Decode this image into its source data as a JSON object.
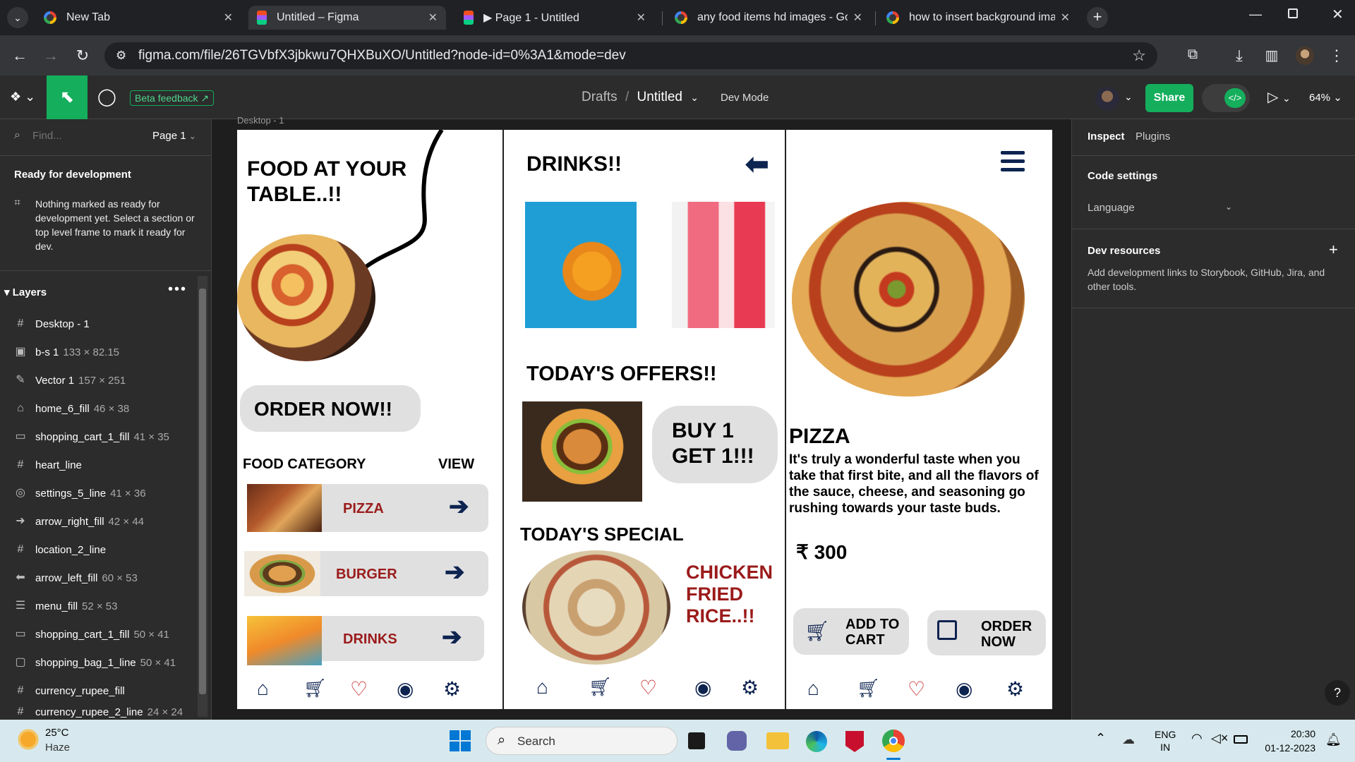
{
  "browser": {
    "tabs": [
      {
        "title": "New Tab"
      },
      {
        "title": "Untitled – Figma"
      },
      {
        "title": "▶ Page 1 - Untitled"
      },
      {
        "title": "any food items hd images - Goo"
      },
      {
        "title": "how to insert background imag"
      }
    ],
    "url": "figma.com/file/26TGVbfX3jbkwu7QHXBuXO/Untitled?node-id=0%3A1&mode=dev"
  },
  "figma": {
    "beta_feedback": "Beta feedback",
    "breadcrumb_drafts": "Drafts",
    "breadcrumb_sep": "/",
    "file_name": "Untitled",
    "dev_mode": "Dev Mode",
    "share": "Share",
    "zoom": "64%",
    "find_placeholder": "Find...",
    "page": "Page 1",
    "ready_title": "Ready for development",
    "ready_text": "Nothing marked as ready for development yet. Select a section or top level frame to mark it ready for dev.",
    "layers_title": "Layers",
    "layers": [
      {
        "name": "Desktop - 1",
        "dim": "",
        "icon": "frame-icon"
      },
      {
        "name": "b-s 1",
        "dim": "133 × 82.15",
        "icon": "image-icon"
      },
      {
        "name": "Vector 1",
        "dim": "157 × 251",
        "icon": "vector-icon"
      },
      {
        "name": "home_6_fill",
        "dim": "46 × 38",
        "icon": "home-icon"
      },
      {
        "name": "shopping_cart_1_fill",
        "dim": "41 × 35",
        "icon": "cart-icon"
      },
      {
        "name": "heart_line",
        "dim": "",
        "icon": "frame-icon"
      },
      {
        "name": "settings_5_line",
        "dim": "41 × 36",
        "icon": "settings-icon"
      },
      {
        "name": "arrow_right_fill",
        "dim": "42 × 44",
        "icon": "arrow-right-icon"
      },
      {
        "name": "location_2_line",
        "dim": "",
        "icon": "frame-icon"
      },
      {
        "name": "arrow_left_fill",
        "dim": "60 × 53",
        "icon": "arrow-left-icon"
      },
      {
        "name": "menu_fill",
        "dim": "52 × 53",
        "icon": "menu-icon"
      },
      {
        "name": "shopping_cart_1_fill",
        "dim": "50 × 41",
        "icon": "cart-icon"
      },
      {
        "name": "shopping_bag_1_line",
        "dim": "50 × 41",
        "icon": "bag-icon"
      },
      {
        "name": "currency_rupee_fill",
        "dim": "",
        "icon": "frame-icon"
      },
      {
        "name": "currency_rupee_2_line",
        "dim": "24 × 24",
        "icon": "frame-icon"
      }
    ],
    "frame_label": "Desktop - 1",
    "inspect_tab": "Inspect",
    "plugins_tab": "Plugins",
    "code_settings": "Code settings",
    "language": "Language",
    "dev_resources": "Dev resources",
    "dev_resources_text": "Add development links to Storybook, GitHub, Jira, and other tools.",
    "help": "?"
  },
  "design": {
    "hero_title": "FOOD AT YOUR TABLE..!!",
    "order_now": "ORDER NOW!!",
    "food_category": "FOOD CATEGORY",
    "view": "VIEW",
    "categories": [
      "PIZZA",
      "BURGER",
      "DRINKS"
    ],
    "drinks_title": "DRINKS!!",
    "offers_title": "TODAY'S OFFERS!!",
    "offer_text": "BUY 1 GET 1!!!",
    "special_title": "TODAY'S SPECIAL",
    "special_name": "CHICKEN FRIED RICE..!!",
    "product_title": "PIZZA",
    "product_desc": "It's truly a wonderful taste when you take that first bite, and all  the flavors of the sauce, cheese, and seasoning go rushing towards your taste buds.",
    "price_symbol": "₹",
    "price": "300",
    "add_to_cart": "ADD TO CART",
    "order_now_btn": "ORDER NOW"
  },
  "taskbar": {
    "temp": "25°C",
    "weather": "Haze",
    "search": "Search",
    "lang": "ENG",
    "region": "IN",
    "time": "20:30",
    "date": "01-12-2023"
  },
  "colors": {
    "accent_red": "#9b1b1b",
    "navy": "#0d2350",
    "share_green": "#14ae5c"
  }
}
